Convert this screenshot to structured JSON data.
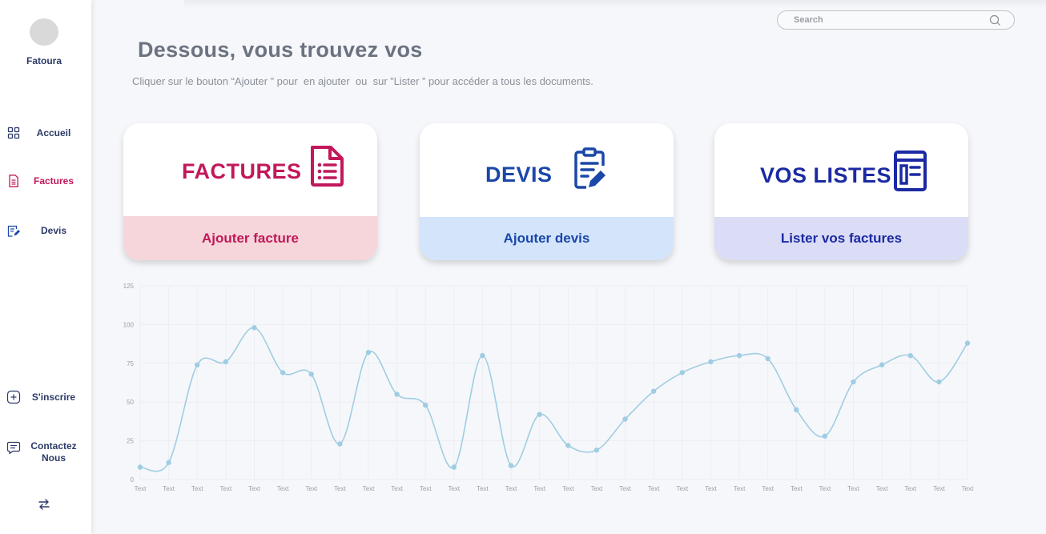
{
  "sidebar": {
    "brand": "Fatoura",
    "items": [
      {
        "label": "Accueil",
        "icon": "grid-icon"
      },
      {
        "label": "Factures",
        "icon": "invoice-icon"
      },
      {
        "label": "Devis",
        "icon": "edit-note-icon"
      }
    ],
    "bottom_items": [
      {
        "label": "S'inscrire",
        "icon": "plus-square-icon"
      },
      {
        "label": "Contactez\nNous",
        "icon": "message-icon"
      }
    ],
    "footer_icon": "swap-arrows-icon"
  },
  "search": {
    "placeholder": "Search",
    "value": ""
  },
  "header": {
    "title": "Dessous, vous trouvez vos",
    "subtitle": "Cliquer sur le bouton “Ajouter ” pour  en ajouter  ou  sur ”Lister ” pour accéder a tous les documents."
  },
  "cards": [
    {
      "title": "FACTURES",
      "action": "Ajouter facture",
      "icon": "invoice-document-icon",
      "color": "#c2185b",
      "action_bg": "#f6d6da"
    },
    {
      "title": "DEVIS",
      "action": "Ajouter devis",
      "icon": "clipboard-edit-icon",
      "color": "#1a47a8",
      "action_bg": "#d3e4fb"
    },
    {
      "title": "VOS LISTES",
      "action": "Lister vos factures",
      "icon": "list-layout-icon",
      "color": "#1b2aa3",
      "action_bg": "#dbdcf5"
    }
  ],
  "chart_data": {
    "type": "line",
    "title": "",
    "xlabel": "",
    "ylabel": "",
    "ylim": [
      0,
      125
    ],
    "yticks": [
      0,
      25,
      50,
      75,
      100,
      125
    ],
    "grid": true,
    "categories": [
      "Text",
      "Text",
      "Text",
      "Text",
      "Text",
      "Text",
      "Text",
      "Text",
      "Text",
      "Text",
      "Text",
      "Text",
      "Text",
      "Text",
      "Text",
      "Text",
      "Text",
      "Text",
      "Text",
      "Text",
      "Text",
      "Text",
      "Text",
      "Text",
      "Text",
      "Text",
      "Text",
      "Text",
      "Text",
      "Text"
    ],
    "series": [
      {
        "values": [
          8,
          11,
          74,
          76,
          98,
          69,
          68,
          23,
          82,
          55,
          48,
          8,
          80,
          9,
          42,
          22,
          19,
          39,
          57,
          69,
          76,
          80,
          78,
          45,
          28,
          63,
          74,
          80,
          63,
          88
        ],
        "color": "#9fcde3"
      }
    ]
  }
}
